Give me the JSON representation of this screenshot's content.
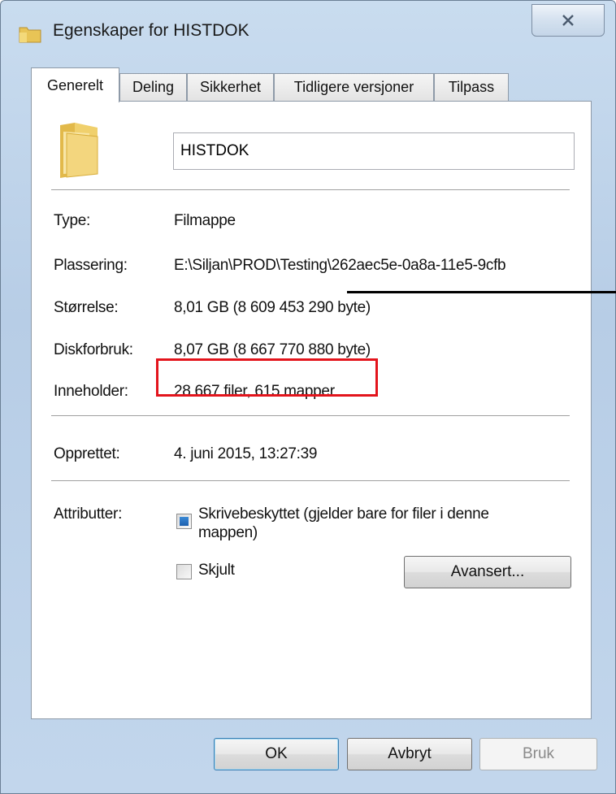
{
  "window": {
    "title": "Egenskaper for HISTDOK"
  },
  "tabs": [
    {
      "label": "Generelt",
      "active": true
    },
    {
      "label": "Deling",
      "active": false
    },
    {
      "label": "Sikkerhet",
      "active": false
    },
    {
      "label": "Tidligere versjoner",
      "active": false
    },
    {
      "label": "Tilpass",
      "active": false
    }
  ],
  "general": {
    "name_value": "HISTDOK",
    "rows": {
      "type": {
        "label": "Type:",
        "value": "Filmappe"
      },
      "location": {
        "label": "Plassering:",
        "value": "E:\\Siljan\\PROD\\Testing\\262aec5e-0a8a-11e5-9cfb"
      },
      "size": {
        "label": "Størrelse:",
        "value": "8,01 GB (8 609 453 290 byte)"
      },
      "disk_usage": {
        "label": "Diskforbruk:",
        "value": "8,07 GB (8 667 770 880 byte)"
      },
      "contains": {
        "label": "Inneholder:",
        "value": "28 667 filer, 615 mapper"
      },
      "created": {
        "label": "Opprettet:",
        "value": "4. juni 2015, 13:27:39"
      }
    },
    "attributes": {
      "label": "Attributter:",
      "readonly_label_line1": "Skrivebeskyttet (gjelder bare for filer i denne",
      "readonly_label_line2": "mappen)",
      "readonly_state": "indeterminate",
      "hidden_label": "Skjult",
      "hidden_checked": false,
      "advanced_button": "Avansert..."
    }
  },
  "footer": {
    "ok": "OK",
    "cancel": "Avbryt",
    "apply": "Bruk"
  },
  "colors": {
    "highlight": "#e3141c",
    "accent": "#1d5fae"
  }
}
